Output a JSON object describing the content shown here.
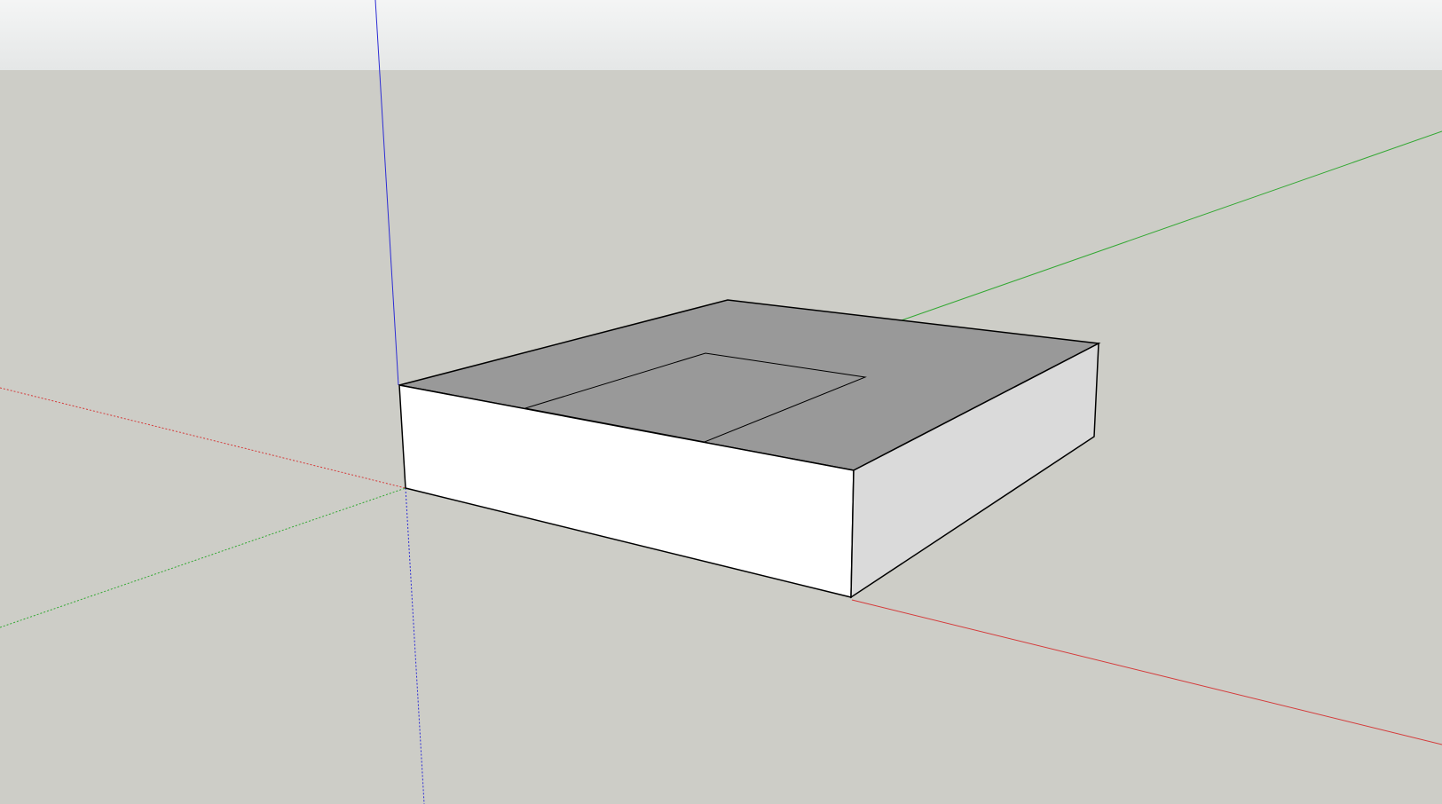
{
  "colors": {
    "sky_top": "#f4f5f5",
    "sky_bottom": "#e5e7e7",
    "ground": "#cdcdc7",
    "x_axis": "#d43b3b",
    "y_axis": "#33a833",
    "z_axis": "#2d2dd4",
    "top_face": "#999999",
    "front_face": "#ffffff",
    "side_face": "#dadada",
    "edge": "#000000"
  },
  "scene": {
    "model": "box-with-top-rectangle",
    "axes": [
      "red",
      "green",
      "blue"
    ]
  }
}
